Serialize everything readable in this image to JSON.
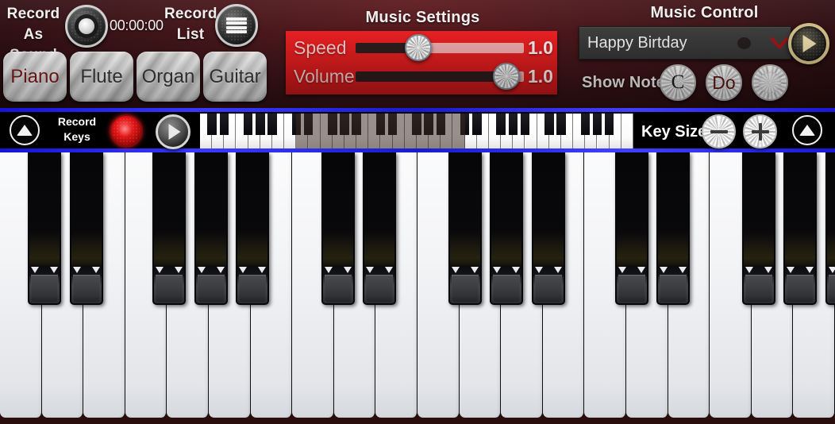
{
  "app": {
    "title": "Piano"
  },
  "record_sound": {
    "label_line1": "Record",
    "label_line2": "As Sound",
    "timer": "00:00:00",
    "button_icon": "record-circle-icon"
  },
  "record_list": {
    "label_line1": "Record",
    "label_line2": "List",
    "button_icon": "list-icon"
  },
  "instruments": {
    "items": [
      {
        "label": "Piano",
        "active": true
      },
      {
        "label": "Flute",
        "active": false
      },
      {
        "label": "Organ",
        "active": false
      },
      {
        "label": "Guitar",
        "active": false
      }
    ],
    "active_color": "#7d1a1a",
    "inactive_color": "#3a3a3a"
  },
  "music_settings": {
    "title": "Music Settings",
    "panel_color": "#e52022",
    "sliders": [
      {
        "label": "Speed",
        "value": "1.0",
        "percent": 35
      },
      {
        "label": "Volume",
        "value": "1.0",
        "percent": 97
      }
    ]
  },
  "music_control": {
    "title": "Music Control",
    "selected_song": "Happy Birtday",
    "dropdown_icon": "chevron-down-icon",
    "play_icon": "play-triangle-icon",
    "show_notes_label": "Show Notes",
    "note_buttons": [
      {
        "id": "c",
        "label": "C",
        "selected": false
      },
      {
        "id": "do",
        "label": "Do",
        "selected": true
      },
      {
        "id": "off",
        "label": "",
        "selected": false
      }
    ]
  },
  "toolbar": {
    "record_keys_line1": "Record",
    "record_keys_line2": "Keys",
    "record_icon": "record-dot-icon",
    "play_icon": "play-triangle-icon",
    "collapse_left_icon": "triangle-up-icon",
    "collapse_right_icon": "triangle-up-icon",
    "key_size_label": "Key Size",
    "key_size_minus": "minus-icon",
    "key_size_plus": "plus-icon",
    "border_color": "#2a2aff"
  },
  "mini_keyboard": {
    "total_white_keys": 36,
    "viewport_start_key": 8,
    "viewport_end_key": 22
  },
  "keyboard": {
    "white_key_count": 20,
    "white_key_width": 52.6,
    "black_key_offsets": [
      35,
      88,
      192,
      245,
      297,
      405,
      457,
      565,
      617,
      670,
      775,
      827,
      935,
      987,
      1040
    ],
    "white_color": "#f3f4f6",
    "black_color": "#09090b"
  }
}
